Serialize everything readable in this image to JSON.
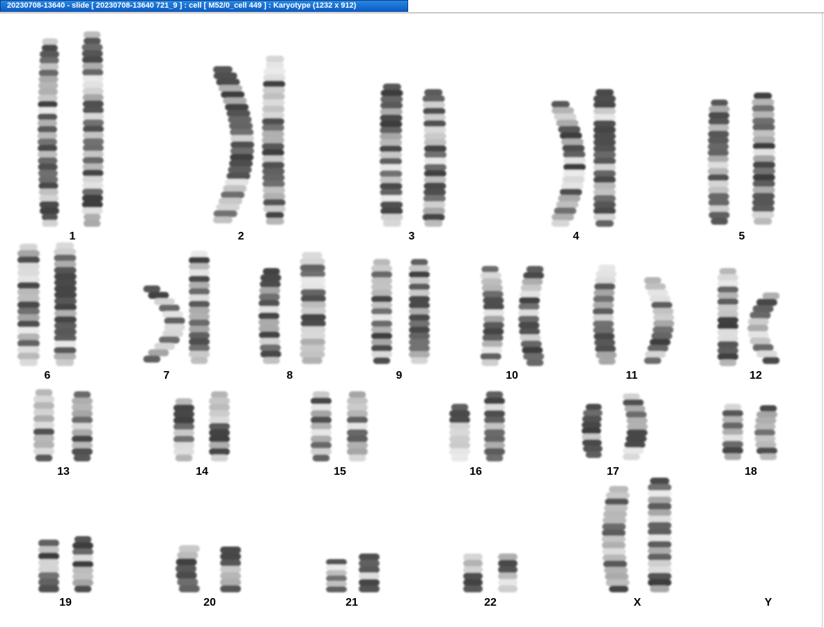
{
  "window": {
    "title": "20230708-13640 - slide [ 20230708-13640 721_9 ] : cell [ M52/0_cell 449 ] : Karyotype  (1232 x 912)"
  },
  "karyotype": {
    "labels": [
      "1",
      "2",
      "3",
      "4",
      "5",
      "6",
      "7",
      "8",
      "9",
      "10",
      "11",
      "12",
      "13",
      "14",
      "15",
      "16",
      "17",
      "18",
      "19",
      "20",
      "21",
      "22",
      "X",
      "Y"
    ]
  },
  "colors": {
    "title_bar": "#0a5ec8",
    "chromosome_dark": "#3a3a3a",
    "chromosome_light": "#d9d9d9"
  }
}
